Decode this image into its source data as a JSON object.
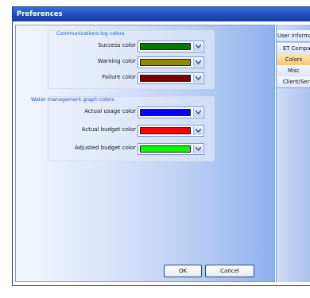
{
  "window": {
    "title": "Preferences"
  },
  "groups": {
    "comm": {
      "title": "Communications log colors",
      "rows": [
        {
          "label": "Success color",
          "color": "#007a00"
        },
        {
          "label": "Warning color",
          "color": "#8f8a00"
        },
        {
          "label": "Failure color",
          "color": "#7a0000"
        }
      ]
    },
    "water": {
      "title": "Water management graph colors",
      "rows": [
        {
          "label": "Actual usage color",
          "color": "#0000ff"
        },
        {
          "label": "Actual budget color",
          "color": "#ff0000"
        },
        {
          "label": "Adjusted budget color",
          "color": "#00ff00"
        }
      ]
    }
  },
  "buttons": {
    "ok": "OK",
    "cancel": "Cancel"
  },
  "tabs": [
    {
      "label": "User Information",
      "active": false
    },
    {
      "label": "ET Comparing",
      "active": false
    },
    {
      "label": "Colors",
      "active": true
    },
    {
      "label": "Misc",
      "active": false
    },
    {
      "label": "Client/Server",
      "active": false
    }
  ]
}
